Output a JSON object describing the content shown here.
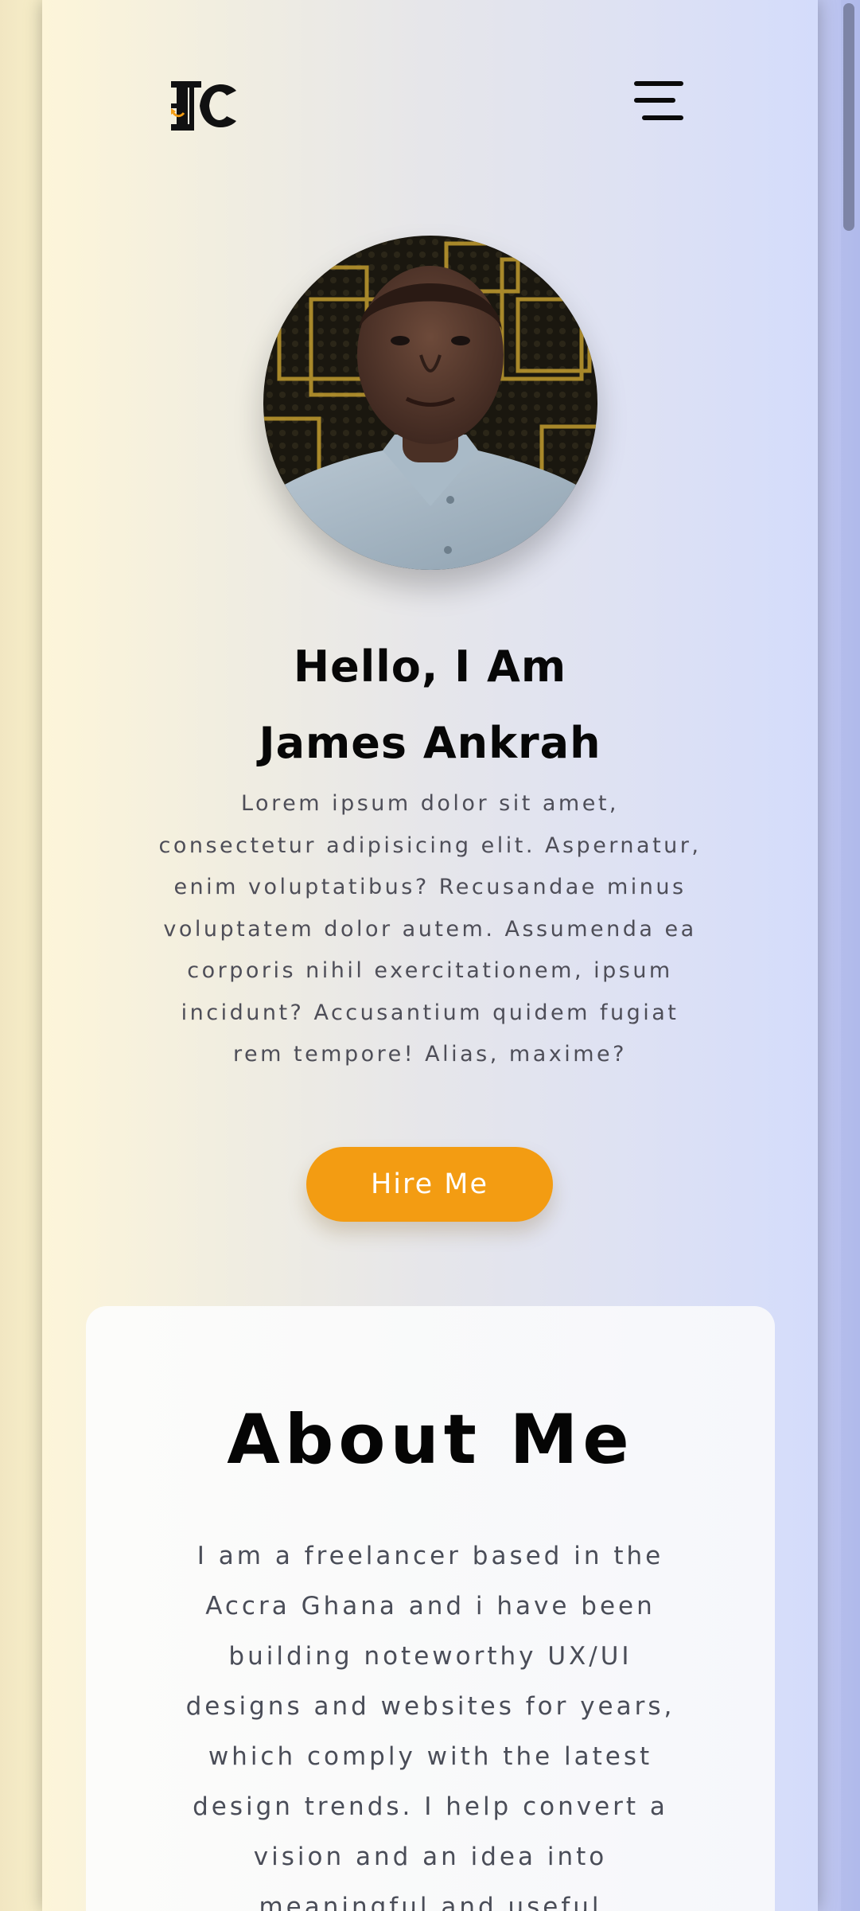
{
  "header": {
    "logo_icon": "jc-monogram-logo",
    "menu_icon": "hamburger-menu-icon"
  },
  "hero": {
    "avatar_alt": "profile-photo",
    "greeting": "Hello, I Am",
    "name": "James Ankrah",
    "intro": "Lorem ipsum dolor sit amet, consectetur adipisicing elit. Aspernatur, enim voluptatibus? Recusandae minus voluptatem dolor autem. Assumenda ea corporis nihil exercitationem, ipsum incidunt? Accusantium quidem fugiat rem tempore! Alias, maxime?",
    "hire_button": "Hire Me"
  },
  "about": {
    "title": "About Me",
    "text": "I am a freelancer based in the Accra Ghana and i have been building noteworthy UX/UI designs and websites for years, which comply with the latest design trends. I help convert a vision and an idea into meaningful and useful"
  },
  "colors": {
    "accent": "#f39c12",
    "heading": "#070707",
    "body_text": "#4e4e58"
  }
}
